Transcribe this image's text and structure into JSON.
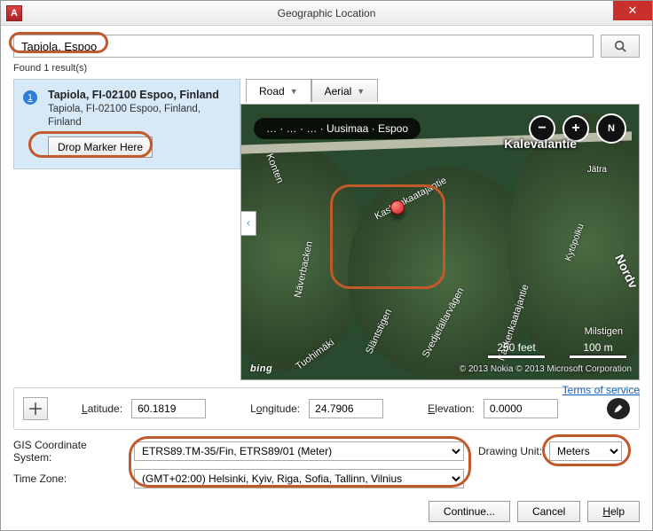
{
  "window": {
    "title": "Geographic Location",
    "app_icon_text": "A"
  },
  "search": {
    "value": "Tapiola, Espoo",
    "results_text": "Found 1 result(s)"
  },
  "result": {
    "badge": "1",
    "title": "Tapiola, FI-02100 Espoo, Finland",
    "subtitle": "Tapiola, FI-02100 Espoo, Finland, Finland",
    "drop_button": "Drop Marker Here"
  },
  "map": {
    "tabs": {
      "road": "Road",
      "aerial": "Aerial"
    },
    "breadcrumb": "… · … · … · Uusimaa · Espoo",
    "road_main": "Kalevalantie",
    "streets": {
      "naverbacken": "Näverbacken",
      "tuohimaki": "Tuohimäki",
      "slantstigen": "Släntstigen",
      "svedjefallarvagen": "Svedjefällarvägen",
      "kaskenkaatajantie": "Kaskenkaatajantie",
      "konten": "Konten",
      "milstigen": "Milstigen",
      "nordv": "Nordv",
      "kytopolku": "Kytöpolku",
      "jatra": "Jätra"
    },
    "scale": {
      "feet": "250 feet",
      "m": "100 m"
    },
    "attribution": "© 2013 Nokia    © 2013 Microsoft Corporation",
    "provider": "bing",
    "tos": "Terms of service"
  },
  "coords": {
    "lat_label": "Latitude:",
    "lat_value": "60.1819",
    "lon_label": "Longitude:",
    "lon_value": "24.7906",
    "elev_label": "Elevation:",
    "elev_value": "0.0000"
  },
  "gis": {
    "cs_label": "GIS Coordinate System:",
    "cs_value": "ETRS89.TM-35/Fin, ETRS89/01 (Meter)",
    "tz_label": "Time Zone:",
    "tz_value": "(GMT+02:00) Helsinki, Kyiv, Riga, Sofia, Tallinn, Vilnius",
    "du_label": "Drawing Unit:",
    "du_value": "Meters"
  },
  "buttons": {
    "continue": "Continue...",
    "cancel": "Cancel",
    "help": "Help"
  }
}
